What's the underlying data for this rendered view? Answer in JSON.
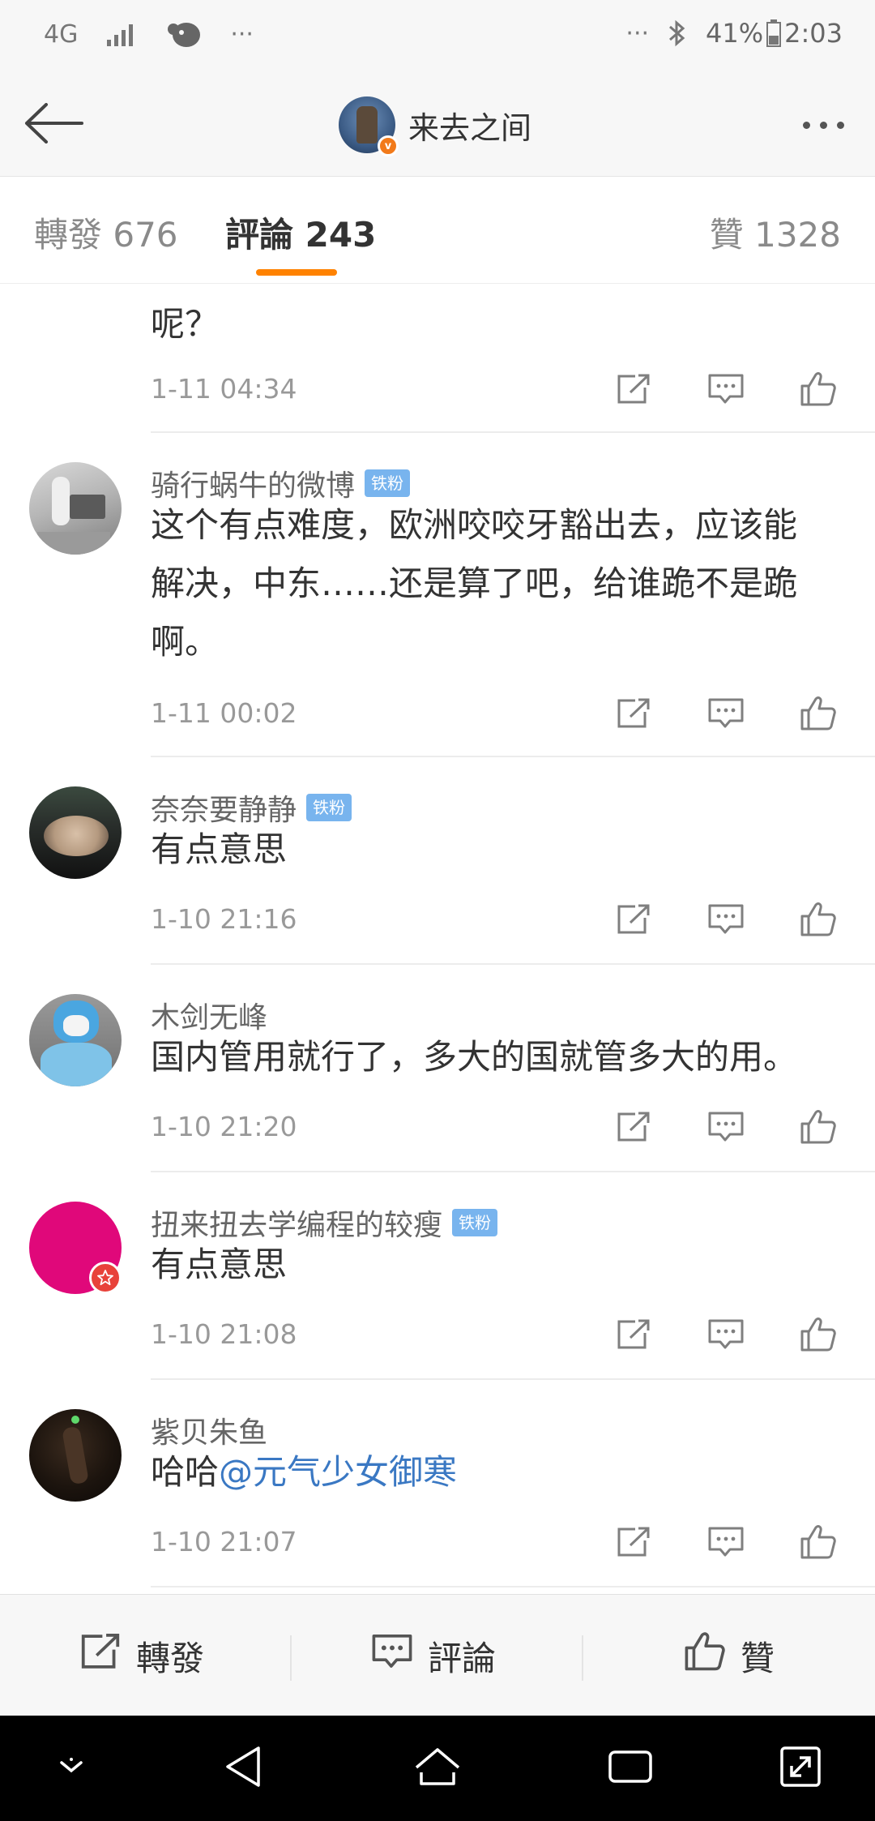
{
  "status_bar": {
    "network": "4G",
    "overflow": "···",
    "overflow_right": "···",
    "battery": "41%",
    "time": "2:03",
    "icons": [
      "4g-icon",
      "signal-icon",
      "app-notification-icon",
      "bluetooth-icon",
      "battery-icon"
    ]
  },
  "header": {
    "title": "来去之间",
    "back_icon": "arrow-left-icon",
    "more_icon": "more-icon",
    "avatar_badge": "v"
  },
  "tabs": [
    {
      "label": "轉發 676",
      "active": false
    },
    {
      "label": "評論 243",
      "active": true
    },
    {
      "label": "贊 1328",
      "active": false
    }
  ],
  "partial_comment": {
    "text": "呢？",
    "time": "1-11 04:34"
  },
  "comments": [
    {
      "user": "骑行蜗牛的微博",
      "badge": "铁粉",
      "lines": [
        "这个有点难度，欧洲咬咬牙豁出去，应该能",
        "解决，中东……还是算了吧，给谁跪不是跪",
        "啊。"
      ],
      "time": "1-11 00:02"
    },
    {
      "user": "奈奈要静静",
      "badge": "铁粉",
      "lines": [
        "有点意思"
      ],
      "time": "1-10 21:16"
    },
    {
      "user": "木剑无峰",
      "badge": "",
      "lines": [
        "国内管用就行了，多大的国就管多大的用。"
      ],
      "time": "1-10 21:20"
    },
    {
      "user": "扭来扭去学编程的较瘦",
      "badge": "铁粉",
      "lines": [
        "有点意思"
      ],
      "time": "1-10 21:08"
    },
    {
      "user": "紫贝朱鱼",
      "badge": "",
      "text_prefix": "哈哈",
      "mention": "@元气少女御寒",
      "time": "1-10 21:07"
    }
  ],
  "actions": {
    "repost": "轉發",
    "comment": "評論",
    "like": "贊"
  },
  "colors": {
    "accent": "#ff8200",
    "badge": "#78b4ee",
    "mention": "#3a78c3",
    "vip_badge": "#f27a1a",
    "avatar_pink": "#e0087a"
  }
}
